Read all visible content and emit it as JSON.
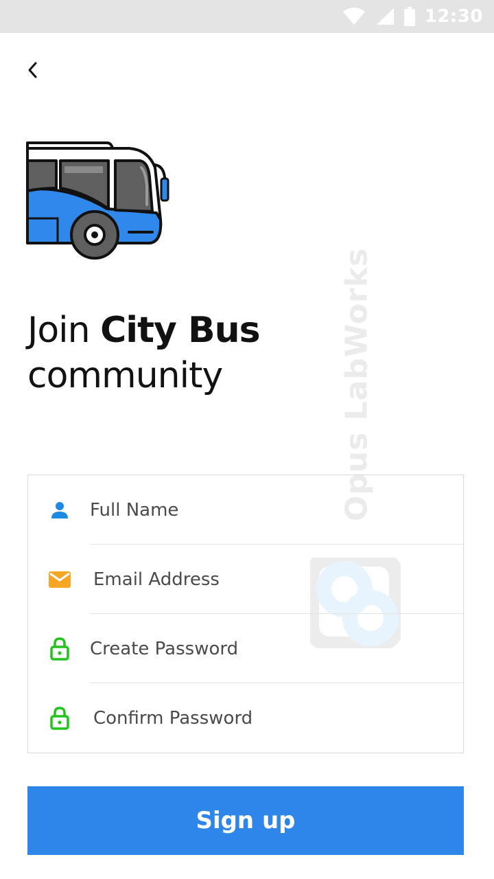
{
  "status_bar": {
    "time": "12:30",
    "icons": [
      "wifi-icon",
      "cellular-signal-icon",
      "battery-icon"
    ]
  },
  "navigation": {
    "back_icon": "chevron-left-icon"
  },
  "hero": {
    "illustration": "bus-icon",
    "headline_prefix": "Join ",
    "headline_brand": "City Bus",
    "headline_suffix": "community"
  },
  "watermark": {
    "text": "Opus LabWorks",
    "logo": "opus-labworks-logo"
  },
  "form": {
    "fields": [
      {
        "placeholder": "Full Name",
        "value": "",
        "icon": "person-icon",
        "icon_color": "#1e88e5"
      },
      {
        "placeholder": "Email Address",
        "value": "",
        "icon": "mail-icon",
        "icon_color": "#f5a623"
      },
      {
        "placeholder": "Create Password",
        "value": "",
        "icon": "lock-icon",
        "icon_color": "#22c41b"
      },
      {
        "placeholder": "Confirm Password",
        "value": "",
        "icon": "lock-icon",
        "icon_color": "#22c41b"
      }
    ]
  },
  "actions": {
    "signup_label": "Sign up"
  },
  "colors": {
    "accent": "#2e86e9",
    "status_bar": "#e4e4e4",
    "bus_blue": "#2f88ea"
  }
}
